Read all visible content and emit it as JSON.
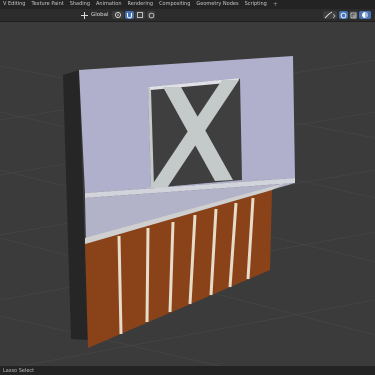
{
  "workspace_tabs": [
    {
      "label": "V Editing"
    },
    {
      "label": "Texture Paint"
    },
    {
      "label": "Shading"
    },
    {
      "label": "Animation"
    },
    {
      "label": "Rendering"
    },
    {
      "label": "Compositing"
    },
    {
      "label": "Geometry Nodes"
    },
    {
      "label": "Scripting"
    }
  ],
  "add_workspace_label": "+",
  "header": {
    "orientation_value": "Global",
    "icons": [
      "transform-orientation-icon",
      "chevron-down-icon",
      "pivot-icon",
      "snap-icon",
      "snap-target-icon",
      "proportional-edit-icon",
      "gizmo-icon",
      "overlay-icon",
      "xray-icon",
      "shading-mode-icon"
    ]
  },
  "status": {
    "left_text": "Lasso Select"
  },
  "colors": {
    "panel_wall": "#b0b0cd",
    "wood": "#8a4219",
    "plank_gap": "#e6dcc8",
    "frame": "#c4c9c9",
    "dark_side": "#262626",
    "grid_line": "#454545",
    "grid_bg": "#3b3b3b",
    "accent": "#4772b3"
  }
}
